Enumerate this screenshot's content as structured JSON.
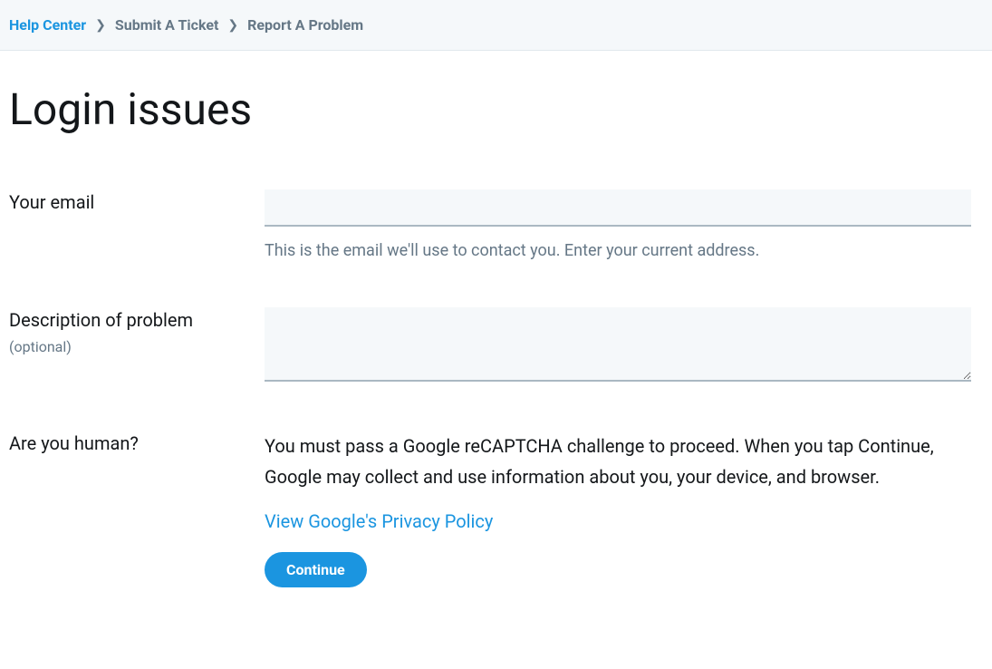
{
  "breadcrumb": {
    "items": [
      {
        "label": "Help Center",
        "link": true
      },
      {
        "label": "Submit A Ticket",
        "link": false
      },
      {
        "label": "Report A Problem",
        "link": false
      }
    ]
  },
  "page": {
    "title": "Login issues"
  },
  "form": {
    "email": {
      "label": "Your email",
      "help": "This is the email we'll use to contact you. Enter your current address.",
      "value": ""
    },
    "description": {
      "label": "Description of problem",
      "optional": "(optional)",
      "value": ""
    },
    "captcha": {
      "label": "Are you human?",
      "text": "You must pass a Google reCAPTCHA challenge to proceed. When you tap Continue, Google may collect and use information about you, your device, and browser.",
      "privacy_link_text": "View Google's Privacy Policy",
      "continue_label": "Continue"
    }
  }
}
